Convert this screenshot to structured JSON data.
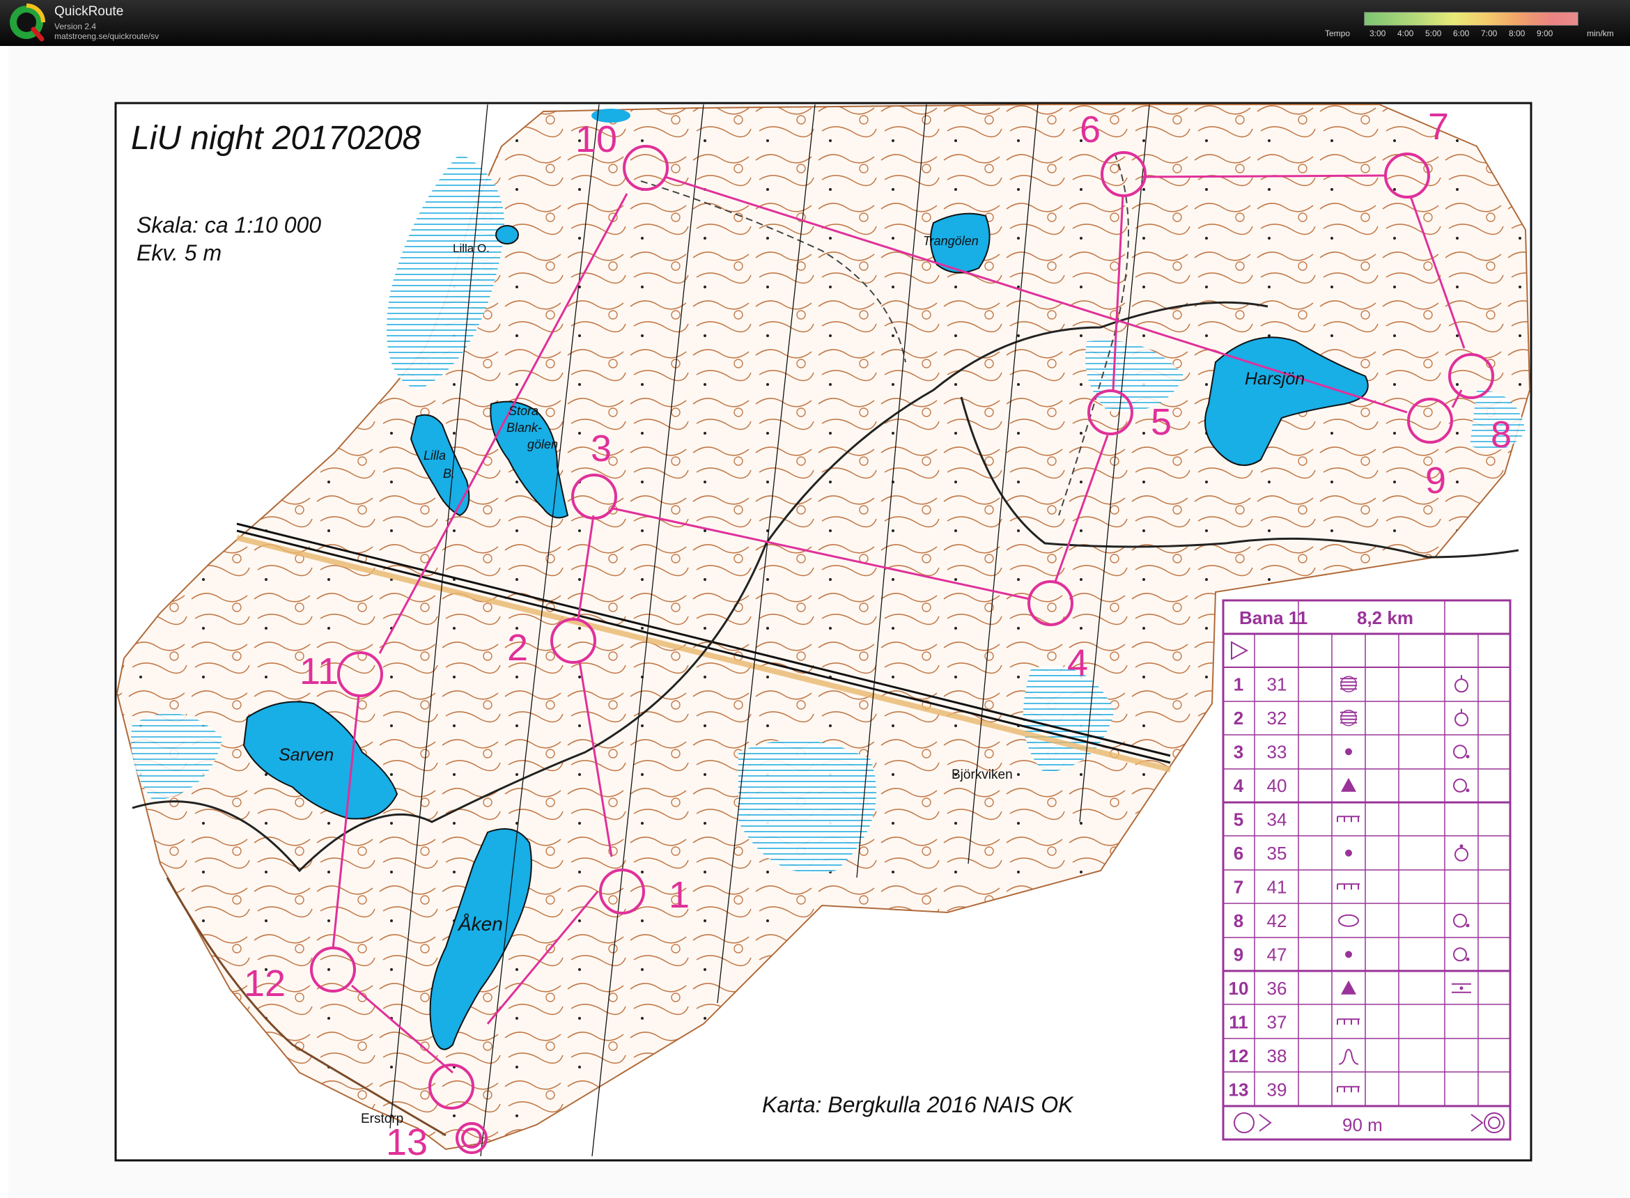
{
  "app": {
    "name": "QuickRoute",
    "version": "Version 2.4",
    "url": "matstroeng.se/quickroute/sv"
  },
  "tempo": {
    "label": "Tempo",
    "ticks": [
      "3:00",
      "4:00",
      "5:00",
      "6:00",
      "7:00",
      "8:00",
      "9:00"
    ],
    "unit": "min/km"
  },
  "map": {
    "title": "LiU night 20170208",
    "scale": "Skala: ca 1:10 000",
    "contour": "Ekv. 5 m",
    "credit": "Karta: Bergkulla 2016 NAIS OK",
    "lakes": [
      "Lilla O.",
      "Trangölen",
      "Harsjön",
      "Stora",
      "Blank-",
      "gölen",
      "Lilla",
      "B.",
      "Sarven",
      "Åken"
    ],
    "places": [
      "Björkviken",
      "Erstorp"
    ],
    "control_labels": [
      "1",
      "2",
      "3",
      "4",
      "5",
      "6",
      "7",
      "8",
      "9",
      "10",
      "11",
      "12",
      "13"
    ]
  },
  "course": {
    "name": "Bana 11",
    "length": "8,2 km",
    "finish_distance": "90 m",
    "controls": [
      {
        "n": "1",
        "code": "31",
        "feature": "knoll-pit-symbol",
        "detail": "foot-symbol"
      },
      {
        "n": "2",
        "code": "32",
        "feature": "knoll-pit-symbol",
        "detail": "foot-symbol"
      },
      {
        "n": "3",
        "code": "33",
        "feature": "dot-symbol",
        "detail": "side-symbol"
      },
      {
        "n": "4",
        "code": "40",
        "feature": "triangle-symbol",
        "detail": "side-symbol"
      },
      {
        "n": "5",
        "code": "34",
        "feature": "marsh-symbol",
        "detail": ""
      },
      {
        "n": "6",
        "code": "35",
        "feature": "dot-symbol",
        "detail": "top-symbol"
      },
      {
        "n": "7",
        "code": "41",
        "feature": "marsh-symbol",
        "detail": ""
      },
      {
        "n": "8",
        "code": "42",
        "feature": "ellipse-symbol",
        "detail": "side-symbol"
      },
      {
        "n": "9",
        "code": "47",
        "feature": "dot-symbol",
        "detail": "side-symbol"
      },
      {
        "n": "10",
        "code": "36",
        "feature": "triangle-symbol",
        "detail": "between-symbol"
      },
      {
        "n": "11",
        "code": "37",
        "feature": "marsh-symbol",
        "detail": ""
      },
      {
        "n": "12",
        "code": "38",
        "feature": "cliff-symbol",
        "detail": ""
      },
      {
        "n": "13",
        "code": "39",
        "feature": "marsh-symbol",
        "detail": ""
      }
    ]
  },
  "colors": {
    "course": "#e0309a",
    "description": "#993399",
    "water": "#18aee6",
    "titlebar": "#111111"
  }
}
